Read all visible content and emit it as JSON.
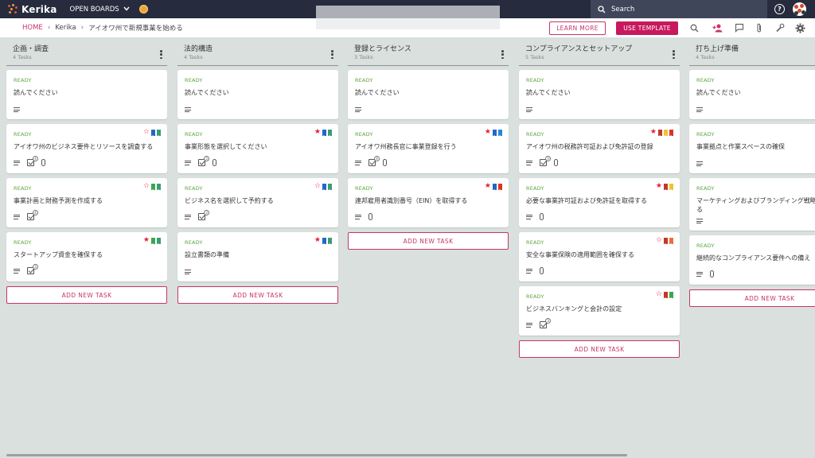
{
  "app": {
    "name": "Kerika",
    "open_boards": "OPEN BOARDS"
  },
  "search": {
    "placeholder": "Search"
  },
  "breadcrumb": {
    "home": "HOME",
    "workspace": "Kerika",
    "board": "アイオワ州で新規事業を始める"
  },
  "actions": {
    "learn_more": "LEARN MORE",
    "use_template": "USE TEMPLATE"
  },
  "add_task_label": "ADD NEW TASK",
  "colors": {
    "accent": "#c8346b",
    "status_ready": "#5aa53a",
    "topbar": "#262b3d",
    "board_bg": "#d9e0de"
  },
  "columns": [
    {
      "title": "企画・調査",
      "count": "4 Tasks",
      "cards": [
        {
          "status": "READY",
          "title": "読んでください",
          "icons": [
            "lines"
          ],
          "flags": []
        },
        {
          "status": "READY",
          "title": "アイオワ州のビジネス要件とリソースを調査する",
          "icons": [
            "lines",
            "check",
            "clip"
          ],
          "check_count": "4",
          "flags": [
            {
              "t": "star-outline"
            },
            {
              "t": "bm",
              "c": "#2466c7"
            },
            {
              "t": "bm",
              "c": "#3a9b76"
            }
          ]
        },
        {
          "status": "READY",
          "title": "事業計画と財務予測を作成する",
          "icons": [
            "lines",
            "check"
          ],
          "check_count": "4",
          "flags": [
            {
              "t": "star-outline"
            },
            {
              "t": "bm",
              "c": "#3aa84a"
            },
            {
              "t": "bm",
              "c": "#3a9b76"
            }
          ]
        },
        {
          "status": "READY",
          "title": "スタートアップ資金を確保する",
          "icons": [
            "lines",
            "check"
          ],
          "check_count": "3",
          "flags": [
            {
              "t": "star"
            },
            {
              "t": "bm",
              "c": "#3aa84a"
            },
            {
              "t": "bm",
              "c": "#3a9b76"
            }
          ]
        }
      ]
    },
    {
      "title": "法的構造",
      "count": "4 Tasks",
      "cards": [
        {
          "status": "READY",
          "title": "読んでください",
          "icons": [
            "lines"
          ],
          "flags": []
        },
        {
          "status": "READY",
          "title": "事業形態を選択してください",
          "icons": [
            "lines",
            "check",
            "clip"
          ],
          "check_count": "3",
          "flags": [
            {
              "t": "star"
            },
            {
              "t": "bm",
              "c": "#2466c7"
            },
            {
              "t": "bm",
              "c": "#3a9b76"
            }
          ]
        },
        {
          "status": "READY",
          "title": "ビジネス名を選択して予約する",
          "icons": [
            "lines",
            "check"
          ],
          "check_count": "3",
          "flags": [
            {
              "t": "star-outline"
            },
            {
              "t": "bm",
              "c": "#2466c7"
            },
            {
              "t": "bm",
              "c": "#3a9b76"
            }
          ]
        },
        {
          "status": "READY",
          "title": "設立書類の準備",
          "icons": [
            "lines"
          ],
          "flags": [
            {
              "t": "star"
            },
            {
              "t": "bm",
              "c": "#2466c7"
            },
            {
              "t": "bm",
              "c": "#3a9b76"
            }
          ]
        }
      ]
    },
    {
      "title": "登録とライセンス",
      "count": "3 Tasks",
      "cards": [
        {
          "status": "READY",
          "title": "読んでください",
          "icons": [
            "lines"
          ],
          "flags": []
        },
        {
          "status": "READY",
          "title": "アイオワ州務長官に事業登録を行う",
          "icons": [
            "lines",
            "check",
            "clip"
          ],
          "check_count": "4",
          "flags": [
            {
              "t": "star"
            },
            {
              "t": "bm",
              "c": "#2466c7"
            },
            {
              "t": "bm",
              "c": "#2a86d7"
            }
          ]
        },
        {
          "status": "READY",
          "title": "連邦雇用者識別番号（EIN）を取得する",
          "icons": [
            "lines",
            "clip"
          ],
          "flags": [
            {
              "t": "star"
            },
            {
              "t": "bm",
              "c": "#2466c7"
            },
            {
              "t": "bm",
              "c": "#d9342b"
            }
          ]
        }
      ]
    },
    {
      "title": "コンプライアンスとセットアップ",
      "count": "5 Tasks",
      "cards": [
        {
          "status": "READY",
          "title": "読んでください",
          "icons": [
            "lines"
          ],
          "flags": []
        },
        {
          "status": "READY",
          "title": "アイオワ州の税務許可証および免許証の登録",
          "icons": [
            "lines",
            "check",
            "clip"
          ],
          "check_count": "3",
          "flags": [
            {
              "t": "star"
            },
            {
              "t": "bm",
              "c": "#c0392b"
            },
            {
              "t": "bm",
              "c": "#f1c232"
            },
            {
              "t": "bm",
              "c": "#d9342b"
            }
          ]
        },
        {
          "status": "READY",
          "title": "必要な事業許可証および免許証を取得する",
          "icons": [
            "lines",
            "clip"
          ],
          "flags": [
            {
              "t": "star"
            },
            {
              "t": "bm",
              "c": "#c0392b"
            },
            {
              "t": "bm",
              "c": "#f1c232"
            }
          ]
        },
        {
          "status": "READY",
          "title": "安全な事業保険の適用範囲を確保する",
          "icons": [
            "lines",
            "clip"
          ],
          "flags": [
            {
              "t": "star-outline"
            },
            {
              "t": "bm",
              "c": "#c0392b"
            },
            {
              "t": "bm",
              "c": "#ef6c3a"
            }
          ]
        },
        {
          "status": "READY",
          "title": "ビジネスバンキングと会計の設定",
          "icons": [
            "lines",
            "check"
          ],
          "check_count": "3",
          "flags": [
            {
              "t": "star-outline"
            },
            {
              "t": "bm",
              "c": "#c0392b"
            },
            {
              "t": "bm",
              "c": "#3aa84a"
            }
          ]
        }
      ]
    },
    {
      "title": "打ち上げ準備",
      "count": "4 Tasks",
      "cards": [
        {
          "status": "READY",
          "title": "読んでください",
          "icons": [
            "lines"
          ],
          "flags": []
        },
        {
          "status": "READY",
          "title": "事業拠点と作業スペースの確保",
          "icons": [
            "lines"
          ],
          "flags": []
        },
        {
          "status": "READY",
          "title": "マーケティングおよびブランディング戦略を策定する",
          "icons": [
            "lines"
          ],
          "flags": [],
          "tall": true
        },
        {
          "status": "READY",
          "title": "継続的なコンプライアンス要件への備え",
          "icons": [
            "lines",
            "clip"
          ],
          "flags": []
        }
      ]
    }
  ]
}
